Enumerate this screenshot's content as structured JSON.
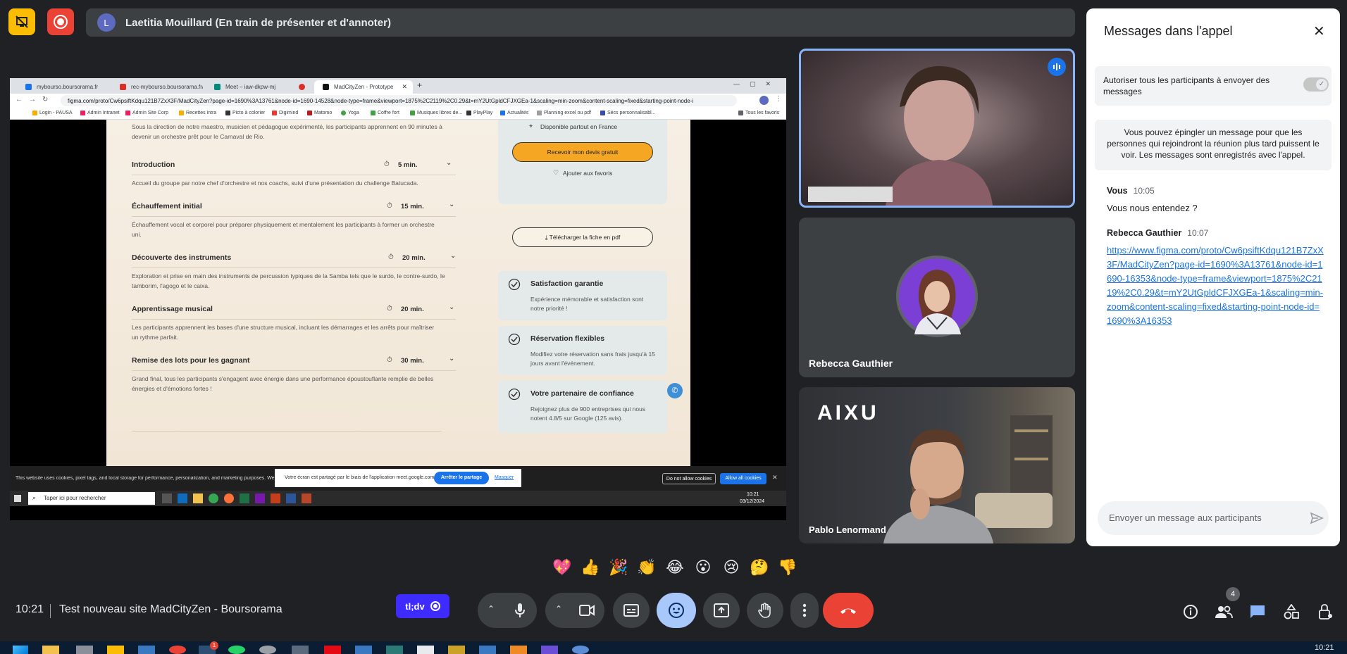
{
  "presenter": {
    "avatar_initial": "L",
    "title": "Laetitia Mouillard (En train de présenter et d'annoter)"
  },
  "shared_screen": {
    "tabs": [
      {
        "label": "mybourso.boursorama.fr",
        "color": "#1a73e8"
      },
      {
        "label": "rec-mybourso.boursorama.fr/r",
        "color": "#d93025"
      },
      {
        "label": "Meet – iaw-dkpw-mj",
        "color": "#00897b"
      },
      {
        "label": "",
        "color": "#d93025"
      },
      {
        "label": "MadCityZen - Prototype",
        "color": "#111111"
      }
    ],
    "url": "figma.com/proto/Cw6psiftKdqu121B7ZxX3F/MadCityZen?page-id=1690%3A13761&node-id=1690-14528&node-type=frame&viewport=1875%2C2119%2C0.29&t=mY2UtGpldCFJXGEa-1&scaling=min-zoom&content-scaling=fixed&starting-point-node-i",
    "bookmarks": [
      "Login - PAUSA",
      "Admin Intranet",
      "Admin Site Corp",
      "Recettes intra",
      "Picto à colorier",
      "Digimind",
      "Matomo",
      "Yoga",
      "Coffre fort",
      "Musiques libres de...",
      "PlayPlay",
      "Actualités",
      "Planning excel ou pdf",
      "Sécs personnalisabl...",
      "Tous les favoris"
    ],
    "intro_text": "Sous la direction de notre maestro, musicien et pédagogue expérimenté, les participants apprennent en 90 minutes à devenir un orchestre prêt pour le Carnaval de Rio.",
    "program": [
      {
        "title": "Introduction",
        "time": "5 min.",
        "desc": "Accueil du groupe par notre chef d'orchestre et nos coachs, suivi d'une présentation du challenge Batucada."
      },
      {
        "title": "Échauffement initial",
        "time": "15 min.",
        "desc": "Échauffement vocal et corporel pour préparer physiquement et mentalement les participants à former un orchestre uni."
      },
      {
        "title": "Découverte des instruments",
        "time": "20 min.",
        "desc": "Exploration et prise en main des instruments de percussion typiques de la Samba tels que le surdo, le contre-surdo, le tamborim, l'agogo et le caixa."
      },
      {
        "title": "Apprentissage musical",
        "time": "20 min.",
        "desc": "Les participants apprennent les bases d'une structure musical, incluant les démarrages et les arrêts pour maîtriser un rythme parfait."
      },
      {
        "title": "Remise des lots pour les gagnant",
        "time": "30 min.",
        "desc": "Grand final, tous les participants s'engagent avec énergie dans une performance époustouflante remplie de belles énergies et d'émotions fortes !"
      }
    ],
    "availability": "Disponible partout en France",
    "quote_button": "Recevoir mon devis gratuit",
    "favorites": "Ajouter aux favoris",
    "pdf_button": "Télécharger la fiche en pdf",
    "features": [
      {
        "title": "Satisfaction garantie",
        "desc": "Expérience mémorable et satisfaction sont notre priorité !"
      },
      {
        "title": "Réservation flexibles",
        "desc": "Modifiez votre réservation sans frais jusqu'à 15 jours avant l'événement."
      },
      {
        "title": "Votre partenaire de confiance",
        "desc": "Rejoignez plus de 900 entreprises qui nous notent 4.8/5 sur Google (125 avis)."
      }
    ],
    "cookie_text": "This website uses cookies, pixel tags, and local storage for performance, personalization, and marketing purposes. We use",
    "share_notice": "Votre écran est partagé par le biais de l'application meet.google.com.",
    "stop_share": "Arrêter le partage",
    "hide": "Masquer",
    "cookie_deny": "Do not allow cookies",
    "cookie_allow": "Allow all cookies",
    "search_placeholder": "Taper ici pour rechercher",
    "tray_time": "10:21",
    "tray_date": "03/12/2024"
  },
  "participants": [
    {
      "name": "",
      "type": "camera"
    },
    {
      "name": "Rebecca Gauthier",
      "type": "avatar"
    },
    {
      "name": "Pablo Lenormand",
      "type": "camera",
      "wall_logo": "AIXU"
    }
  ],
  "chat": {
    "title": "Messages dans l'appel",
    "setting_label": "Autoriser tous les participants à envoyer des messages",
    "pin_info": "Vous pouvez épingler un message pour que les personnes qui rejoindront la réunion plus tard puissent le voir. Les messages sont enregistrés avec l'appel.",
    "messages": [
      {
        "sender": "Vous",
        "time": "10:05",
        "text": "Vous nous entendez ?"
      },
      {
        "sender": "Rebecca Gauthier",
        "time": "10:07",
        "link": "https://www.figma.com/proto/Cw6psiftKdqu121B7ZxX3F/MadCityZen?page-id=1690%3A13761&node-id=1690-16353&node-type=frame&viewport=1875%2C2119%2C0.29&t=mY2UtGpldCFJXGEa-1&scaling=min-zoom&content-scaling=fixed&starting-point-node-id=1690%3A16353"
      }
    ],
    "input_placeholder": "Envoyer un message aux participants"
  },
  "reactions": [
    "💖",
    "👍",
    "🎉",
    "👏",
    "😂",
    "😮",
    "😢",
    "🤔",
    "👎"
  ],
  "bottom": {
    "time": "10:21",
    "meeting_title": "Test nouveau site MadCityZen - Boursorama",
    "tldv_label": "tl;dv",
    "participants_count": "4"
  },
  "os": {
    "time": "10:21",
    "badge": "1"
  },
  "colors": {
    "accent": "#1a73e8",
    "end_call": "#ea4335",
    "record": "#ea4335",
    "present_off": "#fbbc04",
    "tldv": "#3d2bff",
    "quote_btn": "#f5a623"
  }
}
